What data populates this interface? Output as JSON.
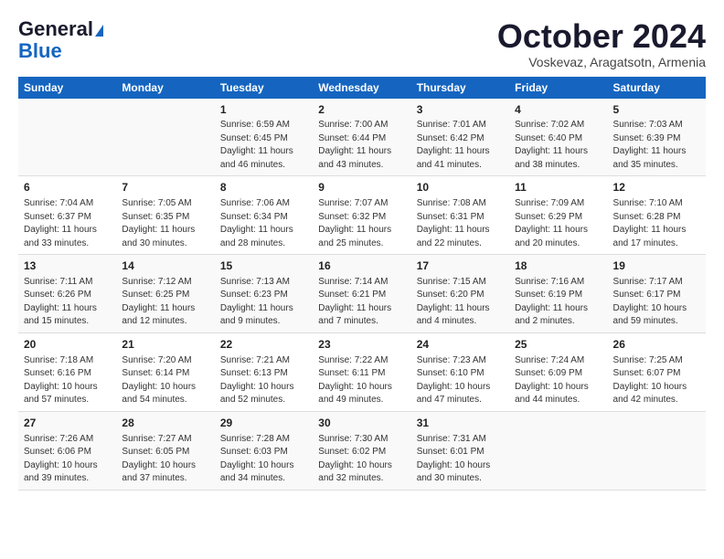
{
  "header": {
    "logo_line1": "General",
    "logo_line2": "Blue",
    "month": "October 2024",
    "location": "Voskevaz, Aragatsotn, Armenia"
  },
  "weekdays": [
    "Sunday",
    "Monday",
    "Tuesday",
    "Wednesday",
    "Thursday",
    "Friday",
    "Saturday"
  ],
  "weeks": [
    [
      {
        "day": "",
        "info": ""
      },
      {
        "day": "",
        "info": ""
      },
      {
        "day": "1",
        "info": "Sunrise: 6:59 AM\nSunset: 6:45 PM\nDaylight: 11 hours and 46 minutes."
      },
      {
        "day": "2",
        "info": "Sunrise: 7:00 AM\nSunset: 6:44 PM\nDaylight: 11 hours and 43 minutes."
      },
      {
        "day": "3",
        "info": "Sunrise: 7:01 AM\nSunset: 6:42 PM\nDaylight: 11 hours and 41 minutes."
      },
      {
        "day": "4",
        "info": "Sunrise: 7:02 AM\nSunset: 6:40 PM\nDaylight: 11 hours and 38 minutes."
      },
      {
        "day": "5",
        "info": "Sunrise: 7:03 AM\nSunset: 6:39 PM\nDaylight: 11 hours and 35 minutes."
      }
    ],
    [
      {
        "day": "6",
        "info": "Sunrise: 7:04 AM\nSunset: 6:37 PM\nDaylight: 11 hours and 33 minutes."
      },
      {
        "day": "7",
        "info": "Sunrise: 7:05 AM\nSunset: 6:35 PM\nDaylight: 11 hours and 30 minutes."
      },
      {
        "day": "8",
        "info": "Sunrise: 7:06 AM\nSunset: 6:34 PM\nDaylight: 11 hours and 28 minutes."
      },
      {
        "day": "9",
        "info": "Sunrise: 7:07 AM\nSunset: 6:32 PM\nDaylight: 11 hours and 25 minutes."
      },
      {
        "day": "10",
        "info": "Sunrise: 7:08 AM\nSunset: 6:31 PM\nDaylight: 11 hours and 22 minutes."
      },
      {
        "day": "11",
        "info": "Sunrise: 7:09 AM\nSunset: 6:29 PM\nDaylight: 11 hours and 20 minutes."
      },
      {
        "day": "12",
        "info": "Sunrise: 7:10 AM\nSunset: 6:28 PM\nDaylight: 11 hours and 17 minutes."
      }
    ],
    [
      {
        "day": "13",
        "info": "Sunrise: 7:11 AM\nSunset: 6:26 PM\nDaylight: 11 hours and 15 minutes."
      },
      {
        "day": "14",
        "info": "Sunrise: 7:12 AM\nSunset: 6:25 PM\nDaylight: 11 hours and 12 minutes."
      },
      {
        "day": "15",
        "info": "Sunrise: 7:13 AM\nSunset: 6:23 PM\nDaylight: 11 hours and 9 minutes."
      },
      {
        "day": "16",
        "info": "Sunrise: 7:14 AM\nSunset: 6:21 PM\nDaylight: 11 hours and 7 minutes."
      },
      {
        "day": "17",
        "info": "Sunrise: 7:15 AM\nSunset: 6:20 PM\nDaylight: 11 hours and 4 minutes."
      },
      {
        "day": "18",
        "info": "Sunrise: 7:16 AM\nSunset: 6:19 PM\nDaylight: 11 hours and 2 minutes."
      },
      {
        "day": "19",
        "info": "Sunrise: 7:17 AM\nSunset: 6:17 PM\nDaylight: 10 hours and 59 minutes."
      }
    ],
    [
      {
        "day": "20",
        "info": "Sunrise: 7:18 AM\nSunset: 6:16 PM\nDaylight: 10 hours and 57 minutes."
      },
      {
        "day": "21",
        "info": "Sunrise: 7:20 AM\nSunset: 6:14 PM\nDaylight: 10 hours and 54 minutes."
      },
      {
        "day": "22",
        "info": "Sunrise: 7:21 AM\nSunset: 6:13 PM\nDaylight: 10 hours and 52 minutes."
      },
      {
        "day": "23",
        "info": "Sunrise: 7:22 AM\nSunset: 6:11 PM\nDaylight: 10 hours and 49 minutes."
      },
      {
        "day": "24",
        "info": "Sunrise: 7:23 AM\nSunset: 6:10 PM\nDaylight: 10 hours and 47 minutes."
      },
      {
        "day": "25",
        "info": "Sunrise: 7:24 AM\nSunset: 6:09 PM\nDaylight: 10 hours and 44 minutes."
      },
      {
        "day": "26",
        "info": "Sunrise: 7:25 AM\nSunset: 6:07 PM\nDaylight: 10 hours and 42 minutes."
      }
    ],
    [
      {
        "day": "27",
        "info": "Sunrise: 7:26 AM\nSunset: 6:06 PM\nDaylight: 10 hours and 39 minutes."
      },
      {
        "day": "28",
        "info": "Sunrise: 7:27 AM\nSunset: 6:05 PM\nDaylight: 10 hours and 37 minutes."
      },
      {
        "day": "29",
        "info": "Sunrise: 7:28 AM\nSunset: 6:03 PM\nDaylight: 10 hours and 34 minutes."
      },
      {
        "day": "30",
        "info": "Sunrise: 7:30 AM\nSunset: 6:02 PM\nDaylight: 10 hours and 32 minutes."
      },
      {
        "day": "31",
        "info": "Sunrise: 7:31 AM\nSunset: 6:01 PM\nDaylight: 10 hours and 30 minutes."
      },
      {
        "day": "",
        "info": ""
      },
      {
        "day": "",
        "info": ""
      }
    ]
  ]
}
